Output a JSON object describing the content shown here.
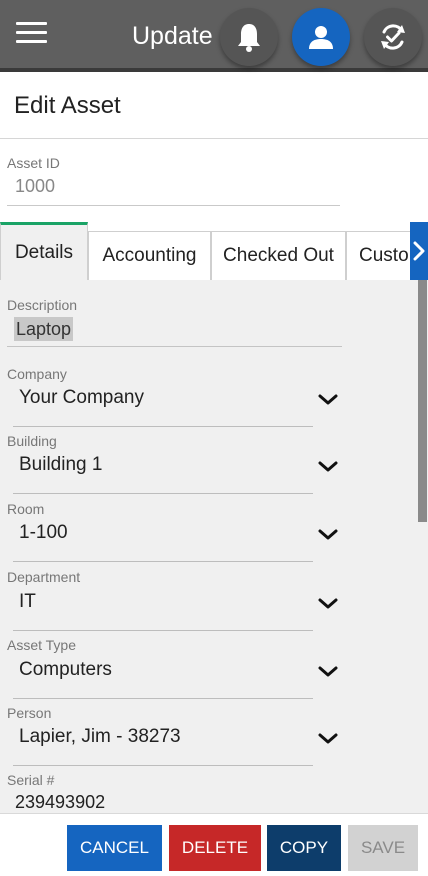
{
  "topbar": {
    "title": "Update",
    "menu_icon": "hamburger-menu-icon",
    "notification_icon": "bell-icon",
    "account_icon": "user-icon",
    "sync_icon": "sync-check-icon",
    "bar_color": "#5f5f5f",
    "account_color": "#1565c0"
  },
  "page": {
    "title": "Edit Asset"
  },
  "asset_id": {
    "label": "Asset ID",
    "value": "1000"
  },
  "tabs": {
    "details": "Details",
    "accounting": "Accounting",
    "checked_out": "Checked Out",
    "custom": "Custo",
    "active": "Details",
    "active_accent_color": "#1aa366",
    "scroll_icon": "chevron-right-icon"
  },
  "fields": {
    "description": {
      "label": "Description",
      "value": "Laptop"
    },
    "company": {
      "label": "Company",
      "value": "Your Company"
    },
    "building": {
      "label": "Building",
      "value": "Building 1"
    },
    "room": {
      "label": "Room",
      "value": "1-100"
    },
    "department": {
      "label": "Department",
      "value": "IT"
    },
    "asset_type": {
      "label": "Asset Type",
      "value": "Computers"
    },
    "person": {
      "label": "Person",
      "value": "Lapier, Jim - 38273"
    },
    "serial": {
      "label": "Serial #",
      "value": "239493902"
    }
  },
  "actions": {
    "cancel": "CANCEL",
    "delete": "DELETE",
    "copy": "COPY",
    "save": "SAVE",
    "cancel_color": "#1565c0",
    "delete_color": "#c62828",
    "copy_color": "#0d3d6b",
    "save_disabled_color": "#d2d2d2"
  }
}
